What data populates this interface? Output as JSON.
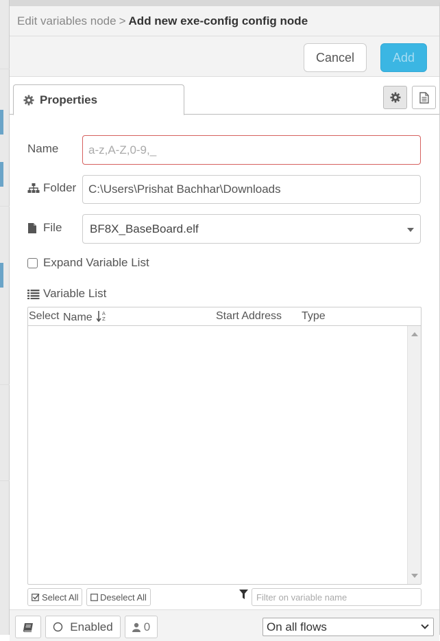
{
  "breadcrumb": {
    "parent": "Edit variables node",
    "separator": ">",
    "current": "Add new exe-config config node"
  },
  "toolbar": {
    "cancel_label": "Cancel",
    "add_label": "Add"
  },
  "tabs": {
    "properties_label": "Properties"
  },
  "form": {
    "name_label": "Name",
    "name_placeholder": "a-z,A-Z,0-9,_",
    "name_value": "",
    "folder_label": "Folder",
    "folder_value": "C:\\Users\\Prishat Bachhar\\Downloads",
    "file_label": "File",
    "file_value": "BF8X_BaseBoard.elf",
    "expand_label": "Expand Variable List",
    "expand_checked": false,
    "variable_list_label": "Variable List"
  },
  "variable_table": {
    "columns": [
      "Select",
      "Name",
      "Start Address",
      "Type"
    ],
    "rows": []
  },
  "list_actions": {
    "select_all": "Select All",
    "deselect_all": "Deselect All",
    "filter_placeholder": "Filter on variable name"
  },
  "footer": {
    "enabled_label": "Enabled",
    "users_count": "0",
    "flows_value": "On all flows"
  },
  "colors": {
    "accent": "#3bb6e3",
    "error_border": "#d6615f"
  }
}
